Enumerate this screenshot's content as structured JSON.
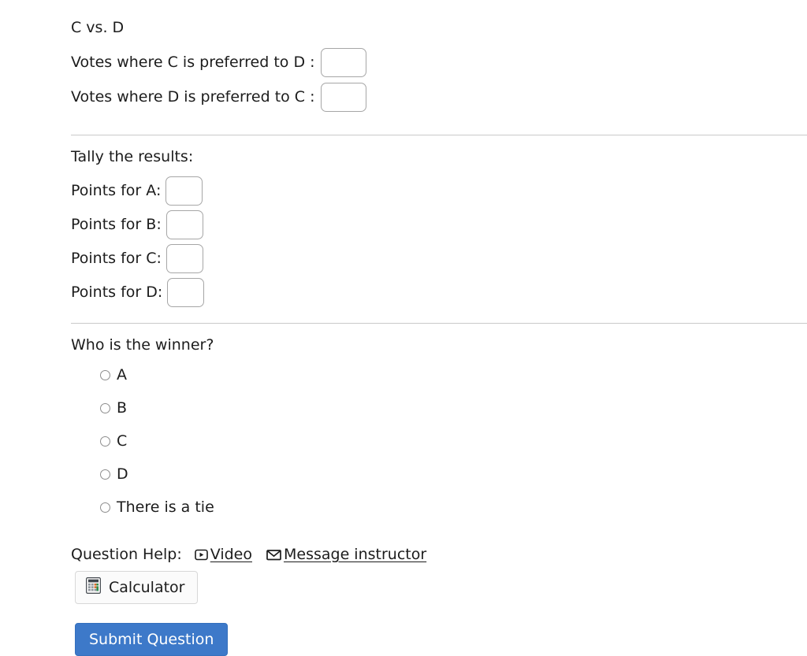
{
  "pairwise": {
    "heading": "C vs. D",
    "rows": [
      {
        "label": "Votes where C is preferred to D :",
        "value": ""
      },
      {
        "label": "Votes where D is preferred to C :",
        "value": ""
      }
    ]
  },
  "tally": {
    "title": "Tally the results:",
    "rows": [
      {
        "label": "Points for A:",
        "value": ""
      },
      {
        "label": "Points for B:",
        "value": ""
      },
      {
        "label": "Points for C:",
        "value": ""
      },
      {
        "label": "Points for D:",
        "value": ""
      }
    ]
  },
  "winner": {
    "question": "Who is the winner?",
    "options": [
      {
        "label": "A",
        "selected": false
      },
      {
        "label": "B",
        "selected": false
      },
      {
        "label": "C",
        "selected": false
      },
      {
        "label": "D",
        "selected": false
      },
      {
        "label": "There is a tie",
        "selected": false
      }
    ]
  },
  "help": {
    "label": "Question Help:",
    "video_link": "Video",
    "video_icon": "play-box-icon",
    "message_link": "Message instructor",
    "message_icon": "envelope-icon",
    "calculator_label": "Calculator",
    "calculator_icon": "calculator-icon"
  },
  "actions": {
    "submit_label": "Submit Question",
    "submit_color": "#3d79c9"
  }
}
